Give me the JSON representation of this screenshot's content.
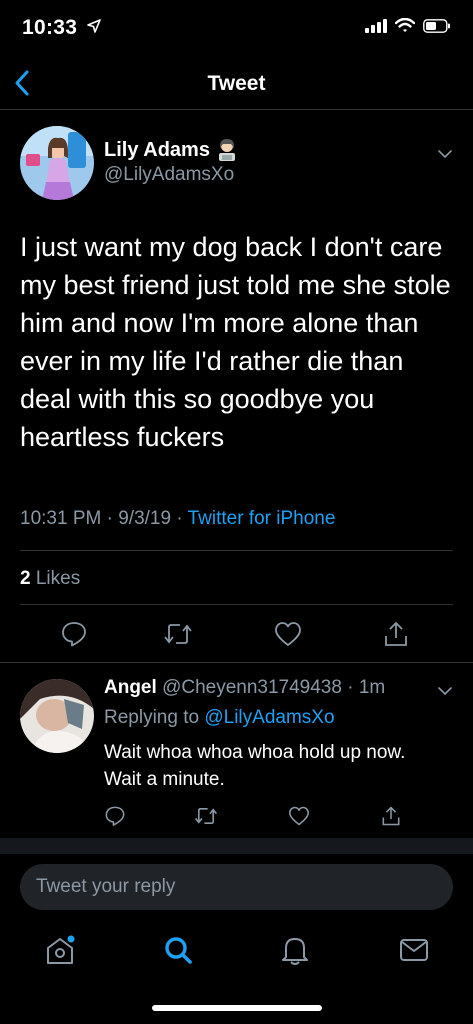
{
  "status_bar": {
    "time": "10:33"
  },
  "nav": {
    "title": "Tweet"
  },
  "tweet": {
    "author_name": "Lily Adams",
    "author_handle": "@LilyAdamsXo",
    "text": "I just want my dog back I don't care my best friend just told me she stole him and now I'm more alone than ever in my life I'd rather die than deal with this so goodbye you heartless fuckers",
    "time": "10:31 PM",
    "date": "9/3/19",
    "source": "Twitter for iPhone",
    "likes_count": "2",
    "likes_label": "Likes"
  },
  "reply": {
    "author_name": "Angel",
    "author_handle": "@Cheyenn31749438",
    "time": "1m",
    "replying_prefix": "Replying to",
    "replying_to": "@LilyAdamsXo",
    "text": "Wait whoa whoa whoa hold up now. Wait a minute."
  },
  "compose": {
    "placeholder": "Tweet your reply"
  },
  "colors": {
    "accent": "#1da1f2",
    "muted": "#8b98a5",
    "background": "#000000"
  },
  "icons": [
    "location-arrow-icon",
    "signal-icon",
    "wifi-icon",
    "battery-icon",
    "back-chevron-icon",
    "woman-technologist-emoji-icon",
    "chevron-down-icon",
    "reply-icon",
    "retweet-icon",
    "like-icon",
    "share-icon",
    "home-icon",
    "search-icon",
    "notifications-icon",
    "messages-icon"
  ]
}
